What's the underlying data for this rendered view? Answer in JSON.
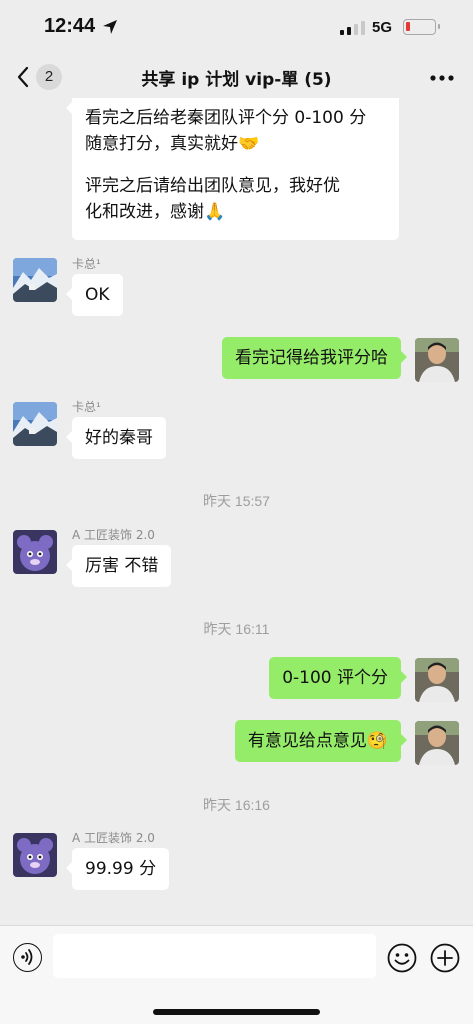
{
  "status_bar": {
    "time": "12:44",
    "network": "5G",
    "battery_color": "#e53935"
  },
  "nav": {
    "unread_count": "2",
    "title": "共享 ip 计划 vip-單 (5)"
  },
  "messages": [
    {
      "type": "text",
      "side": "left",
      "lines": [
        "看完之后给老秦团队评个分 0-100 分",
        "随意打分，真实就好🤝",
        "",
        "评完之后请给出团队意见，我好优",
        "化和改进，感谢🙏"
      ]
    },
    {
      "type": "text",
      "side": "left",
      "sender": "卡总¹",
      "text": "OK"
    },
    {
      "type": "text",
      "side": "right",
      "text": "看完记得给我评分哈"
    },
    {
      "type": "text",
      "side": "left",
      "sender": "卡总¹",
      "text": "好的秦哥"
    },
    {
      "type": "time",
      "text": "昨天 15:57"
    },
    {
      "type": "text",
      "side": "left",
      "sender": "A 工匠装饰 2.0",
      "text": "厉害 不错"
    },
    {
      "type": "time",
      "text": "昨天 16:11"
    },
    {
      "type": "text",
      "side": "right",
      "text": "0-100 评个分"
    },
    {
      "type": "text",
      "side": "right",
      "text": "有意见给点意见🧐"
    },
    {
      "type": "time",
      "text": "昨天 16:16"
    },
    {
      "type": "text",
      "side": "left",
      "sender": "A 工匠装饰 2.0",
      "text": "99.99 分"
    }
  ],
  "input": {
    "value": "",
    "placeholder": ""
  },
  "icons": {
    "back": "chevron-left-icon",
    "more": "more-horizontal-icon",
    "voice": "voice-icon",
    "emoji": "emoji-icon",
    "plus": "plus-icon"
  },
  "colors": {
    "self_bubble": "#95ec69",
    "other_bubble": "#ffffff",
    "background": "#ededed"
  }
}
